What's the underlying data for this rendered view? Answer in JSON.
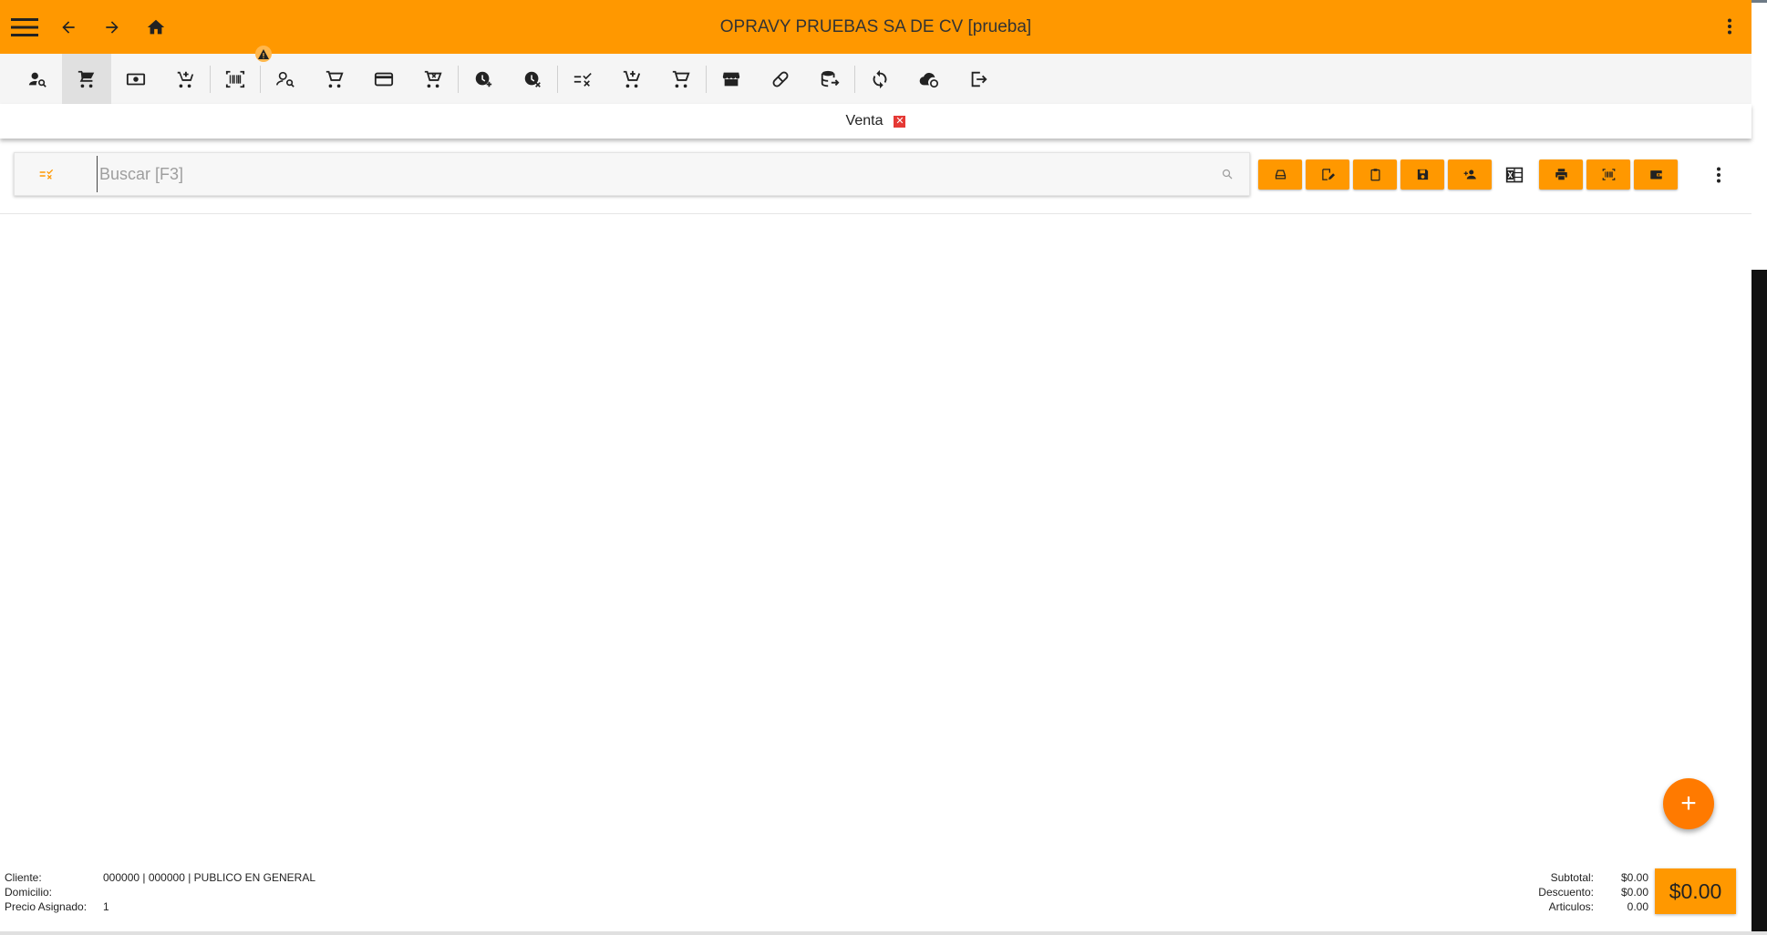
{
  "app": {
    "title": "OPRAVY PRUEBAS SA DE CV [prueba]",
    "accent_color": "#ff9800"
  },
  "topbar": {
    "icons": [
      "menu-icon",
      "arrow-back-icon",
      "arrow-forward-icon",
      "home-icon",
      "more-vert-icon"
    ]
  },
  "iconbar": {
    "icons": [
      "person-search-icon",
      "cart-icon",
      "cash-icon",
      "cart-add-icon",
      "barcode-scan-icon",
      "customer-search-icon",
      "cart-outline-icon",
      "credit-card-icon",
      "cart-remove-icon",
      "clock-add-icon",
      "clock-remove-icon",
      "list-check-icon",
      "cart-plus-icon",
      "cart-check-icon",
      "store-icon",
      "pill-icon",
      "database-export-icon",
      "sync-icon",
      "cloud-sync-icon",
      "logout-icon"
    ],
    "warning_badge": "warning-icon"
  },
  "tabs": [
    {
      "label": "Venta",
      "close": "✕"
    }
  ],
  "search": {
    "placeholder": "Buscar [F3]",
    "value": ""
  },
  "actions": {
    "buttons": [
      "cash-drawer-icon",
      "edit-note-icon",
      "clipboard-icon",
      "save-icon",
      "add-person-icon",
      "excel-icon",
      "print-icon",
      "barcode-icon",
      "wallet-icon",
      "more-vert-icon"
    ]
  },
  "fab": {
    "label": "+"
  },
  "footer": {
    "cliente_label": "Cliente:",
    "cliente_value": "000000 | 000000 | PUBLICO EN GENERAL",
    "domicilio_label": "Domicilio:",
    "domicilio_value": "",
    "precio_label": "Precio Asignado:",
    "precio_value": "1",
    "subtotal_label": "Subtotal:",
    "subtotal_value": "$0.00",
    "descuento_label": "Descuento:",
    "descuento_value": "$0.00",
    "articulos_label": "Articulos:",
    "articulos_value": "0.00",
    "total": "$0.00"
  }
}
